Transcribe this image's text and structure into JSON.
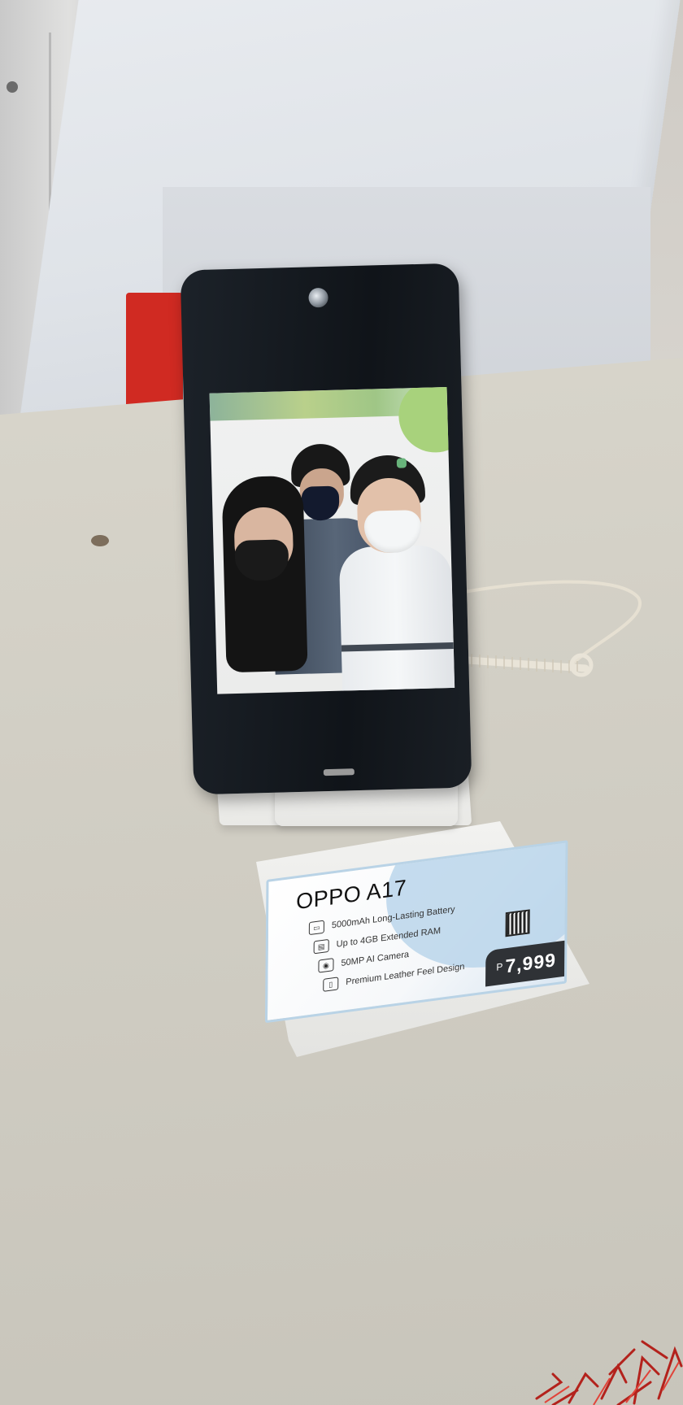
{
  "card": {
    "title": "OPPO A17",
    "features": [
      {
        "icon": "battery-icon",
        "text": "5000mAh Long-Lasting Battery"
      },
      {
        "icon": "ram-icon",
        "text": "Up to 4GB Extended RAM"
      },
      {
        "icon": "camera-icon",
        "text": "50MP AI Camera"
      },
      {
        "icon": "phone-design-icon",
        "text": "Premium Leather Feel Design"
      }
    ],
    "price_currency": "P",
    "price_amount": "7,999"
  },
  "colors": {
    "price_tag": "#2f3236",
    "card_accent": "#b6d3ea",
    "phone_body": "#12161b",
    "counter": "#e2e6eb",
    "table": "#d3d0c6"
  }
}
